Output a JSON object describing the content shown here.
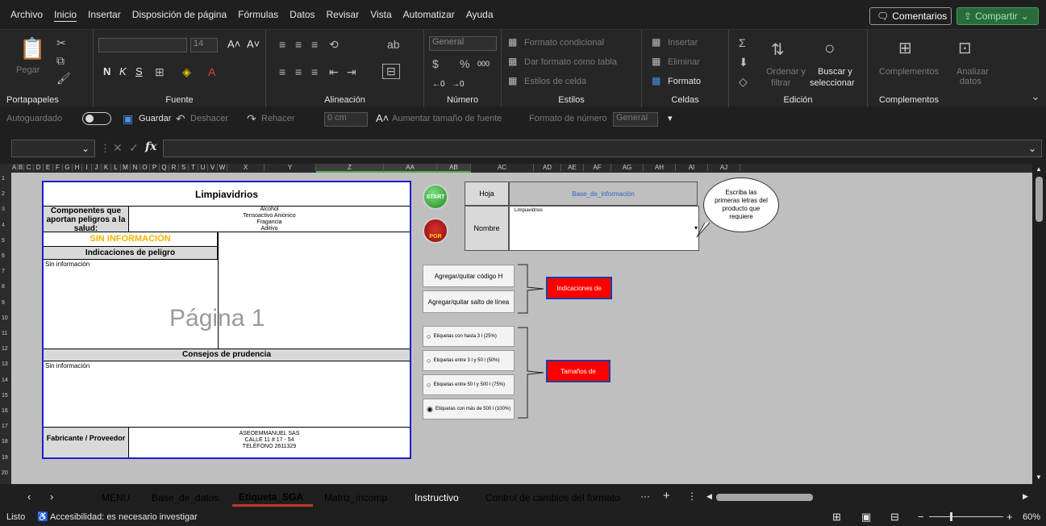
{
  "menu": {
    "tabs": [
      "Archivo",
      "Inicio",
      "Insertar",
      "Disposición de página",
      "Fórmulas",
      "Datos",
      "Revisar",
      "Vista",
      "Automatizar",
      "Ayuda"
    ],
    "comments_label": "Comentarios",
    "share_label": "Compartir"
  },
  "ribbon": {
    "clipboard": {
      "paste": "Pegar",
      "label": "Portapapeles"
    },
    "font": {
      "size": "14",
      "bold": "N",
      "italic": "K",
      "underline": "S",
      "label": "Fuente"
    },
    "alignment": {
      "label": "Alineación"
    },
    "number": {
      "format": "General",
      "label": "Número"
    },
    "styles": {
      "conditional": "Formato condicional",
      "table": "Dar formato como tabla",
      "cell": "Estilos de celda",
      "label": "Estilos"
    },
    "cells": {
      "insert": "Insertar",
      "delete": "Eliminar",
      "format": "Formato",
      "label": "Celdas"
    },
    "editing": {
      "sort": "Ordenar y",
      "filter": "filtrar",
      "find": "Buscar y",
      "select": "seleccionar",
      "label": "Edición"
    },
    "addins": {
      "addins": "Complementos",
      "analyze": "Analizar",
      "data": "datos",
      "label": "Complementos"
    }
  },
  "qat": {
    "autosave": "Autoguardado",
    "save": "Guardar",
    "undo": "Deshacer",
    "redo": "Rehacer",
    "indent": "0 cm",
    "grow_font": "Aumentar tamaño de fuente",
    "number_format": "Formato de número",
    "number_format_value": "General"
  },
  "formula_bar": {
    "name_box": "",
    "fx": "fx",
    "value": ""
  },
  "columns": [
    "A",
    "B",
    "C",
    "D",
    "E",
    "F",
    "G",
    "H",
    "I",
    "J",
    "K",
    "L",
    "M",
    "N",
    "O",
    "P",
    "Q",
    "R",
    "S",
    "T",
    "U",
    "V",
    "W",
    "X",
    "Y",
    "Z",
    "AA",
    "AB",
    "AC",
    "AD",
    "AE",
    "AF",
    "AG",
    "AH",
    "AI",
    "AJ"
  ],
  "rows": [
    "1",
    "2",
    "3",
    "4",
    "5",
    "6",
    "7",
    "8",
    "9",
    "10",
    "11",
    "12",
    "13",
    "14",
    "15",
    "16",
    "17",
    "18",
    "19",
    "20"
  ],
  "label": {
    "product": "Limpiavidrios",
    "components_header": "Componentes que aportan peligros a la salud:",
    "components": [
      "Alcohol",
      "Tensoactivo Aniónico",
      "Fragancia",
      "Aditivo"
    ],
    "signal_word": "SIN INFORMACIÓN",
    "hazards_header": "Indicaciones de peligro",
    "hazards_text": "Sin información",
    "watermark": "Página 1",
    "precautions_header": "Consejos de prudencia",
    "precautions_text": "Sin información",
    "supplier_header": "Fabricante / Proveedor",
    "supplier_name": "ASEOEMMANUEL SAS",
    "supplier_address": "CALLE 11 # 17 - 54",
    "supplier_phone": "TELÉFONO 2611329"
  },
  "controls": {
    "start_label": "START",
    "pgr_label": "PGR",
    "sheet_label": "Hoja",
    "sheet_value": "Base_de_información",
    "name_label": "Nombre",
    "name_value": "Limpiavidrios",
    "callout": "Escriba las primeras letras del producto que requiere",
    "add_h_code": "Agregar/quitar código H",
    "add_line_break": "Agregar/quitar salto de línea",
    "indications": "Indicaciones de",
    "sizes": "Tamaños de",
    "radios": [
      {
        "label": "Etiquetas con hasta 3 l (25%)",
        "checked": false
      },
      {
        "label": "Etiquetas entre 3 l y 50 l (50%)",
        "checked": false
      },
      {
        "label": "Etiquetas entre 50 l y 500 l (75%)",
        "checked": false
      },
      {
        "label": "Etiquetas con más de 500 l (100%)",
        "checked": true
      }
    ]
  },
  "sheets": [
    {
      "name": "MENU",
      "color": "#ffff00"
    },
    {
      "name": "Base_de_datos",
      "color": "#f4a460"
    },
    {
      "name": "Etiqueta_SGA",
      "color": "#ffd7db"
    },
    {
      "name": "Matriz_incomp",
      "color": "#92d050"
    },
    {
      "name": "Instructivo",
      "color": "#2f75b5"
    },
    {
      "name": "Control de cambios del formato",
      "color": "#9bc2e6"
    }
  ],
  "status": {
    "ready": "Listo",
    "accessibility": "Accesibilidad: es necesario investigar",
    "zoom": "60%"
  }
}
